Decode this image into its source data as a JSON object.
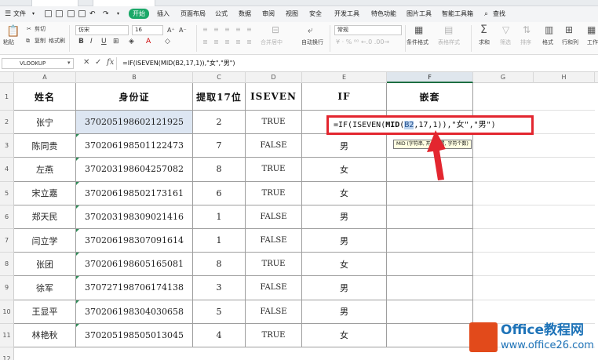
{
  "menubar": {
    "file": "文件",
    "items": [
      "开始",
      "插入",
      "页面布局",
      "公式",
      "数据",
      "审阅",
      "视图",
      "安全",
      "开发工具",
      "特色功能",
      "图片工具",
      "智能工具箱"
    ],
    "search": "查找"
  },
  "ribbon": {
    "paste": "粘贴",
    "cut": "剪切",
    "copy": "复制",
    "format_painter": "格式刷",
    "font_name": "仿宋",
    "font_size": "16",
    "merge_center": "合并居中",
    "wrap_text": "自动换行",
    "number_format": "常规",
    "conditional_format": "条件格式",
    "table_style": "表格样式",
    "sum": "求和",
    "filter": "筛选",
    "sort": "排序",
    "format": "格式",
    "row_col": "行和列",
    "worksheet": "工作"
  },
  "formula_bar": {
    "name_box": "VLOOKUP",
    "formula": "=IF(ISEVEN(MID(B2,17,1)),\"女\",\"男\")"
  },
  "columns": [
    "A",
    "B",
    "C",
    "D",
    "E",
    "F",
    "G",
    "H"
  ],
  "table": {
    "headers": [
      "姓名",
      "身份证",
      "提取17位",
      "ISEVEN",
      "IF",
      "嵌套"
    ],
    "rows": [
      {
        "name": "张宁",
        "id": "370205198602121925",
        "digit": "2",
        "iseven": "TRUE",
        "if": "",
        "nest": ""
      },
      {
        "name": "陈同贵",
        "id": "370206198501122473",
        "digit": "7",
        "iseven": "FALSE",
        "if": "男",
        "nest": ""
      },
      {
        "name": "左燕",
        "id": "370203198604257082",
        "digit": "8",
        "iseven": "TRUE",
        "if": "女",
        "nest": ""
      },
      {
        "name": "宋立嘉",
        "id": "370206198502173161",
        "digit": "6",
        "iseven": "TRUE",
        "if": "女",
        "nest": ""
      },
      {
        "name": "郑天民",
        "id": "370203198309021416",
        "digit": "1",
        "iseven": "FALSE",
        "if": "男",
        "nest": ""
      },
      {
        "name": "闫立学",
        "id": "370206198307091614",
        "digit": "1",
        "iseven": "FALSE",
        "if": "男",
        "nest": ""
      },
      {
        "name": "张团",
        "id": "370206198605165081",
        "digit": "8",
        "iseven": "TRUE",
        "if": "女",
        "nest": ""
      },
      {
        "name": "徐军",
        "id": "370727198706174138",
        "digit": "3",
        "iseven": "FALSE",
        "if": "男",
        "nest": ""
      },
      {
        "name": "王显平",
        "id": "370206198304030658",
        "digit": "5",
        "iseven": "FALSE",
        "if": "男",
        "nest": ""
      },
      {
        "name": "林艳秋",
        "id": "370205198505013045",
        "digit": "4",
        "iseven": "TRUE",
        "if": "女",
        "nest": ""
      }
    ]
  },
  "editing": {
    "formula_prefix": "=IF(ISEVEN(",
    "func": "MID",
    "ref": "B2",
    "formula_suffix": ",17,1)),\"女\",\"男\")",
    "tooltip": "MID (字符串, 开始位置, 字符个数)"
  },
  "watermark": {
    "line1": "Office教程网",
    "line2": "www.office26.com"
  },
  "colors": {
    "accent_green": "#1aa868",
    "highlight_red": "#e3262f",
    "selected_cell": "#dde6f2"
  }
}
